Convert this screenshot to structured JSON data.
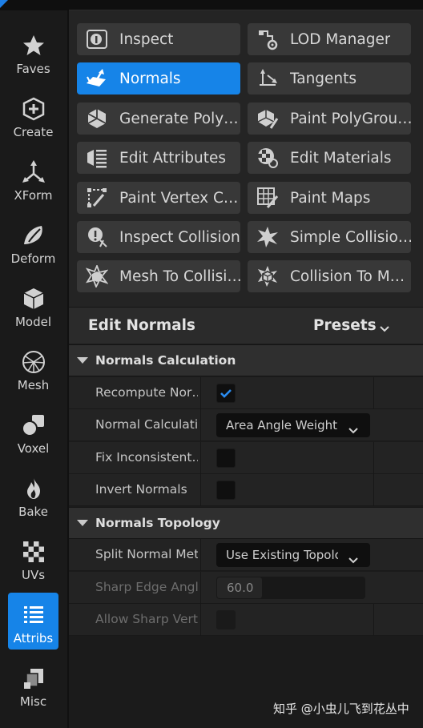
{
  "sidebar": {
    "items": [
      {
        "label": "Faves",
        "icon": "star-icon",
        "active": false
      },
      {
        "label": "Create",
        "icon": "create-cube-icon",
        "active": false
      },
      {
        "label": "XForm",
        "icon": "transform-axes-icon",
        "active": false
      },
      {
        "label": "Deform",
        "icon": "deform-icon",
        "active": false
      },
      {
        "label": "Model",
        "icon": "model-cube-icon",
        "active": false
      },
      {
        "label": "Mesh",
        "icon": "mesh-icon",
        "active": false
      },
      {
        "label": "Voxel",
        "icon": "voxel-icon",
        "active": false
      },
      {
        "label": "Bake",
        "icon": "flame-icon",
        "active": false
      },
      {
        "label": "UVs",
        "icon": "checker-icon",
        "active": false
      },
      {
        "label": "Attribs",
        "icon": "attribs-list-icon",
        "active": true
      },
      {
        "label": "Misc",
        "icon": "misc-icon",
        "active": false
      }
    ]
  },
  "tools": [
    {
      "label": "Inspect",
      "icon": "inspect-icon",
      "active": false
    },
    {
      "label": "LOD Manager",
      "icon": "lod-manager-icon",
      "active": false
    },
    {
      "label": "Normals",
      "icon": "normals-icon",
      "active": true
    },
    {
      "label": "Tangents",
      "icon": "tangents-icon",
      "active": false
    },
    {
      "label": "Generate Poly…",
      "icon": "generate-polygroups-icon",
      "active": false
    },
    {
      "label": "Paint PolyGrou…",
      "icon": "paint-polygroups-icon",
      "active": false
    },
    {
      "label": "Edit Attributes",
      "icon": "edit-attributes-icon",
      "active": false
    },
    {
      "label": "Edit Materials",
      "icon": "edit-materials-icon",
      "active": false
    },
    {
      "label": "Paint Vertex C…",
      "icon": "paint-vertex-colors-icon",
      "active": false
    },
    {
      "label": "Paint Maps",
      "icon": "paint-maps-icon",
      "active": false
    },
    {
      "label": "Inspect Collision",
      "icon": "inspect-collision-icon",
      "active": false
    },
    {
      "label": "Simple Collisio…",
      "icon": "simple-collision-icon",
      "active": false
    },
    {
      "label": "Mesh To Collisi…",
      "icon": "mesh-to-collision-icon",
      "active": false
    },
    {
      "label": "Collision To M…",
      "icon": "collision-to-mesh-icon",
      "active": false
    }
  ],
  "details": {
    "title": "Edit Normals",
    "presets_label": "Presets"
  },
  "sections": {
    "calc": {
      "title": "Normals Calculation",
      "recompute": {
        "label": "Recompute Nor…",
        "checked": true
      },
      "method": {
        "label": "Normal Calculati…",
        "value": "Area Angle Weightir"
      },
      "fix": {
        "label": "Fix Inconsistent…",
        "checked": false
      },
      "invert": {
        "label": "Invert Normals",
        "checked": false
      }
    },
    "topology": {
      "title": "Normals Topology",
      "split": {
        "label": "Split Normal Met…",
        "value": "Use Existing Topolc"
      },
      "sharp_angle": {
        "label": "Sharp Edge Angl…",
        "value": "60.0"
      },
      "allow_sharp": {
        "label": "Allow Sharp Vert…",
        "checked": false
      }
    }
  },
  "watermark": "知乎 @小虫儿飞到花丛中",
  "colors": {
    "accent": "#1684e8",
    "button": "#383838",
    "panel": "#242424",
    "background": "#1b1b1b"
  }
}
